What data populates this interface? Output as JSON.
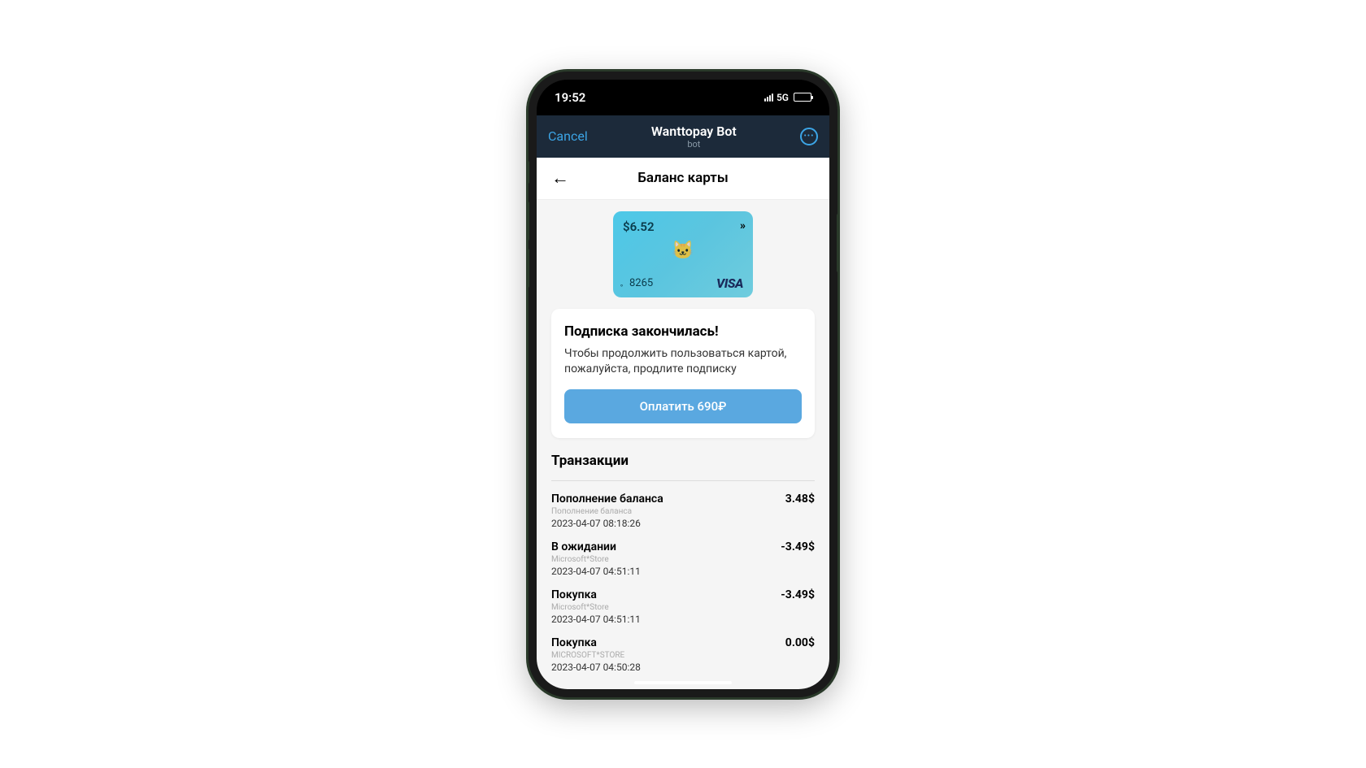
{
  "status": {
    "time": "19:52",
    "network": "5G"
  },
  "nav": {
    "cancel": "Cancel",
    "title": "Wanttopay Bot",
    "subtitle": "bot"
  },
  "page": {
    "title": "Баланс карты"
  },
  "card": {
    "balance": "$6.52",
    "last4": "8265",
    "brand": "VISA"
  },
  "notice": {
    "title": "Подписка закончилась!",
    "text": "Чтобы продолжить пользоваться картой, пожалуйста, продлите подписку",
    "button": "Оплатить 690₽"
  },
  "transactions": {
    "title": "Транзакции",
    "items": [
      {
        "name": "Пополнение баланса",
        "amount": "3.48$",
        "merchant": "Пополнение баланса",
        "date": "2023-04-07 08:18:26"
      },
      {
        "name": "В ожидании",
        "amount": "-3.49$",
        "merchant": "Microsoft*Store",
        "date": "2023-04-07 04:51:11"
      },
      {
        "name": "Покупка",
        "amount": "-3.49$",
        "merchant": "Microsoft*Store",
        "date": "2023-04-07 04:51:11"
      },
      {
        "name": "Покупка",
        "amount": "0.00$",
        "merchant": "MICROSOFT*STORE",
        "date": "2023-04-07 04:50:28"
      }
    ]
  }
}
